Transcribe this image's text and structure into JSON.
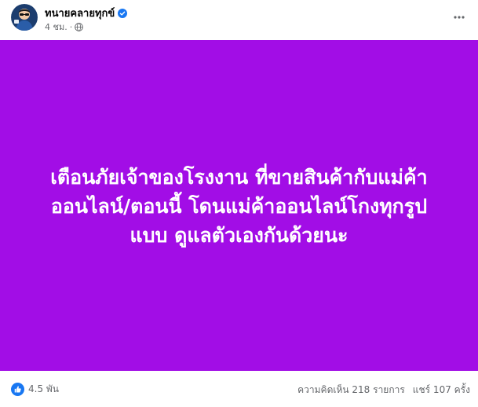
{
  "post": {
    "author": {
      "name": "ทนายคลายทุกข์",
      "verified": true
    },
    "meta": {
      "time": "4 ชม.",
      "separator": "·",
      "audience_icon": "globe-icon"
    },
    "more_icon": "more-horizontal-icon",
    "background_color": "#a20de6",
    "text_lines": [
      "เตือนภัยเจ้าของโรงงาน ที่ขายสินค้ากับแม่ค้า",
      "ออนไลน์/ตอนนี้ โดนแม่ค้าออนไลน์โกงทุกรูป",
      "แบบ ดูแลตัวเองกันด้วยนะ"
    ],
    "footer": {
      "reaction_icon": "like-icon",
      "reaction_count": "4.5 พัน",
      "comments": "ความคิดเห็น 218 รายการ",
      "shares": "แชร์ 107 ครั้ง"
    },
    "colors": {
      "primary_text": "#050505",
      "secondary_text": "#65676b",
      "facebook_blue": "#1877f2"
    }
  }
}
